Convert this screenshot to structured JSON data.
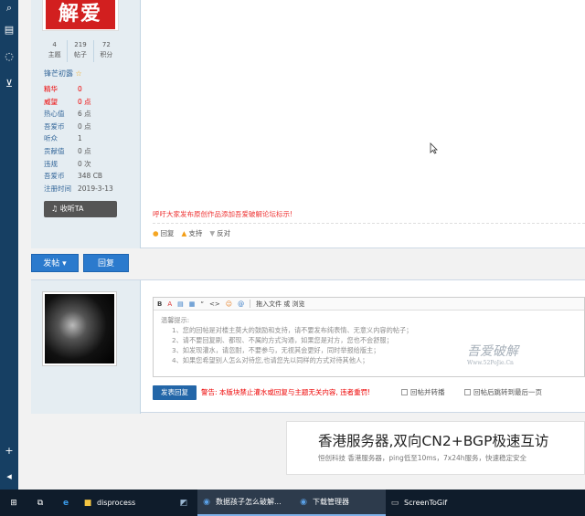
{
  "leftbar": {
    "icons": [
      "search-icon",
      "ebook-icon",
      "chat-icon",
      "cart-icon",
      "plus-icon",
      "collapse-icon"
    ]
  },
  "author": {
    "avatar_text": "解爱",
    "stats": [
      {
        "value": "4",
        "label": "主题"
      },
      {
        "value": "219",
        "label": "帖子"
      },
      {
        "value": "72",
        "label": "积分"
      }
    ],
    "name": "锋芒初露",
    "info": [
      {
        "k": "精华",
        "v": "0",
        "style": "red"
      },
      {
        "k": "威望",
        "v": "0 点",
        "style": "red"
      },
      {
        "k": "热心值",
        "v": "6 点",
        "style": ""
      },
      {
        "k": "吾爱币",
        "v": "0 点",
        "style": ""
      },
      {
        "k": "听众",
        "v": "1",
        "style": ""
      },
      {
        "k": "贡献值",
        "v": "0 点",
        "style": ""
      },
      {
        "k": "违规",
        "v": "0 次",
        "style": ""
      },
      {
        "k": "吾爱币",
        "v": "348 CB",
        "style": ""
      },
      {
        "k": "注册时间",
        "v": "2019-3-13",
        "style": ""
      }
    ],
    "listen_label": "收听TA"
  },
  "post": {
    "notice": "呼吁大家发布原创作品添加吾爱破解论坛标示!",
    "actions": {
      "reply": "回复",
      "support": "支持",
      "oppose": "反对"
    }
  },
  "buttons": {
    "post": "发帖 ▾",
    "reply": "回复"
  },
  "reply_box": {
    "toolbar": [
      "B",
      "A",
      "▤",
      "▦",
      "“",
      "<>",
      "☺",
      "@"
    ],
    "drag_text": "拖入文件 或 浏览",
    "hints_title": "温馨提示:",
    "hints": [
      "1、您的回帖是对楼主莫大的鼓励和支持，请不要发布纯表情、无意义内容的帖子；",
      "2、请不要回复刷、都现、不属的方式沟通，如果您是对方，您也不会舒服；",
      "3、如发现灌水，请忽耐，不要参与，无视其会更好，同时举报给版主；",
      "4、如果您希望别人怎么对待您,也请您先以同样的方式对待其他人；"
    ],
    "watermark": "吾爱破解",
    "watermark_url": "Www.52PoJie.Cn",
    "submit": "发表回复",
    "warning": "警告: 本版块禁止灌水或回复与主题无关内容, 违者重罚!",
    "check1": "回帖并转播",
    "check2": "回帖后跳转到最后一页"
  },
  "ad": {
    "title": "香港服务器,双向CN2+BGP极速互访",
    "subtitle": "恒创科技 香港服务器，ping低至10ms，7x24h服务，快速稳定安全"
  },
  "taskbar": {
    "items": [
      {
        "label": "",
        "icon": "windows-icon"
      },
      {
        "label": "",
        "icon": "task-view-icon"
      },
      {
        "label": "",
        "icon": "edge-icon"
      },
      {
        "label": "disprocess",
        "icon": "folder-icon"
      },
      {
        "label": "",
        "icon": "tool-icon"
      },
      {
        "label": "数据孩子怎么破解...",
        "icon": "browser-icon"
      },
      {
        "label": "下载管理器",
        "icon": "download-icon"
      },
      {
        "label": "ScreenToGif",
        "icon": "screentogif-icon"
      }
    ]
  }
}
